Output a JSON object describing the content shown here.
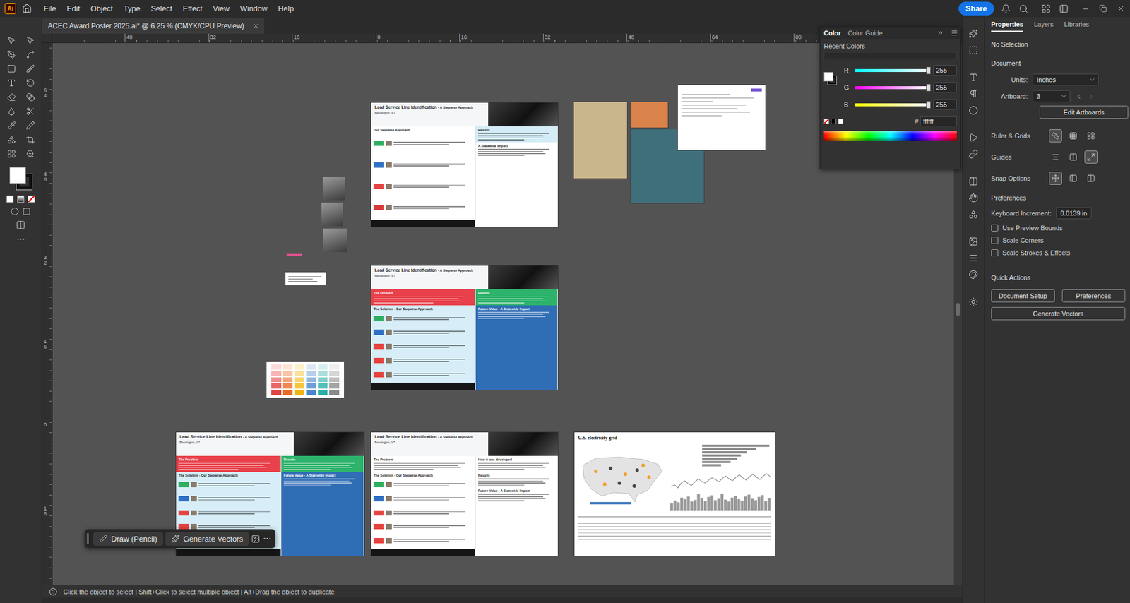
{
  "menu_bar": {
    "logo": "Ai",
    "items": [
      "File",
      "Edit",
      "Object",
      "Type",
      "Select",
      "Effect",
      "View",
      "Window",
      "Help"
    ],
    "share": "Share"
  },
  "document_tab": {
    "title": "ACEC Award Poster 2025.ai* @ 6.25 % (CMYK/CPU Preview)",
    "selected": true
  },
  "rulers": {
    "horizontal": [
      "48",
      "32",
      "16",
      "0",
      "16",
      "32",
      "48",
      "64",
      "80"
    ],
    "vertical": [
      "64",
      "48",
      "32",
      "16",
      "0",
      "16"
    ]
  },
  "artboards": [
    {
      "kind": "poster",
      "title": "Lead Service Line Identification",
      "subtitle": "- A Stepwise Approach",
      "location": "Bennington, VT",
      "left": [
        {
          "heading": "Our Stepwise Approach",
          "color": "#ffffff",
          "steps": [
            {
              "color": "#2fae5f"
            },
            {
              "color": "#2f6fc4"
            },
            {
              "color": "#e5433f"
            },
            {
              "color": "#d63a3a"
            }
          ]
        }
      ],
      "right": [
        {
          "heading": "Results",
          "color": "#d4ecf7"
        },
        {
          "heading": "A Statewide Impact",
          "color": "#ffffff"
        }
      ]
    },
    {
      "kind": "poster",
      "title": "Lead Service Line Identification",
      "subtitle": "- A Stepwise Approach",
      "location": "Bennington, VT",
      "left": [
        {
          "heading": "The Problem",
          "color": "#e8414b"
        },
        {
          "heading": "The Solution - Our Stepwise Approach",
          "color": "#d7eef8",
          "steps": [
            {
              "color": "#2fae5f"
            },
            {
              "color": "#2f6fc4"
            },
            {
              "color": "#e5433f"
            },
            {
              "color": "#e5433f"
            },
            {
              "color": "#e5433f"
            }
          ]
        }
      ],
      "right": [
        {
          "heading": "Results",
          "color": "#2db36b"
        },
        {
          "heading": "Future Value - A Statewide Impact",
          "color": "#2f6db5"
        }
      ]
    },
    {
      "kind": "poster",
      "title": "Lead Service Line Identification",
      "subtitle": "- A Stepwise Approach",
      "location": "Bennington, VT",
      "left": [
        {
          "heading": "The Problem",
          "color": "#e8414b"
        },
        {
          "heading": "The Solution - Our Stepwise Approach",
          "color": "#d7eef8",
          "steps": [
            {
              "color": "#2fae5f"
            },
            {
              "color": "#2f6fc4"
            },
            {
              "color": "#e5433f"
            },
            {
              "color": "#e5433f"
            },
            {
              "color": "#e5433f"
            }
          ]
        }
      ],
      "right": [
        {
          "heading": "Results",
          "color": "#2db36b"
        },
        {
          "heading": "Future Value - A Statewide Impact",
          "color": "#2f6db5"
        }
      ]
    },
    {
      "kind": "poster",
      "title": "Lead Service Line Identification",
      "subtitle": "- A Stepwise Approach",
      "location": "Bennington, VT",
      "left": [
        {
          "heading": "The Problem",
          "color": "#ffffff"
        },
        {
          "heading": "The Solution - Our Stepwise Approach",
          "color": "#ffffff",
          "steps": [
            {
              "color": "#2fae5f"
            },
            {
              "color": "#2f6fc4"
            },
            {
              "color": "#e5433f"
            },
            {
              "color": "#e5433f"
            },
            {
              "color": "#e5433f"
            }
          ]
        }
      ],
      "right": [
        {
          "heading": "How it was developed",
          "color": "#ffffff"
        },
        {
          "heading": "Results",
          "color": "#ffffff"
        },
        {
          "heading": "Future Value - A Statewide Impact",
          "color": "#ffffff"
        }
      ]
    },
    {
      "kind": "report",
      "title": "U.S. electricity grid",
      "bars": [
        9.2,
        7.4,
        6.1,
        5.3,
        4.8,
        3.9,
        2.6
      ],
      "line": [
        52,
        55,
        50,
        58,
        62,
        57,
        54,
        60,
        65,
        61,
        58,
        63,
        67,
        64,
        60,
        66,
        70,
        65,
        62,
        68,
        72,
        67,
        63,
        69,
        73,
        68,
        64,
        70,
        74,
        69
      ],
      "area": [
        30,
        42,
        35,
        55,
        48,
        60,
        38,
        45,
        70,
        52,
        40,
        58,
        65,
        44,
        50,
        72,
        46,
        38,
        55,
        62,
        48,
        42,
        60,
        68,
        50,
        44,
        58,
        66,
        40,
        52
      ]
    }
  ],
  "references": [
    {
      "kind": "photo",
      "color": "#c9b68c"
    },
    {
      "kind": "photo",
      "color": "#d9824a"
    },
    {
      "kind": "photo",
      "color": "#3f6f7a"
    },
    {
      "kind": "screenshot",
      "color": "#ffffff"
    }
  ],
  "photos": [
    {
      "kind": "photo"
    },
    {
      "kind": "photo"
    },
    {
      "kind": "photo"
    }
  ],
  "swatch": {
    "columns": [
      [
        "#fbdada",
        "#f6b4b4",
        "#f08e8e",
        "#ea6868",
        "#e24444"
      ],
      [
        "#fde3d3",
        "#f9c4a6",
        "#f5a57a",
        "#f0874e",
        "#ea6a24"
      ],
      [
        "#fdf0c8",
        "#fbe29a",
        "#f8d46b",
        "#f5c63d",
        "#eeb612"
      ],
      [
        "#dbe7f5",
        "#b7cfeb",
        "#92b7e0",
        "#6d9fd6",
        "#4887cb"
      ],
      [
        "#d4efee",
        "#a9dfdc",
        "#7ecfcb",
        "#53bfb9",
        "#2aaea7"
      ],
      [
        "#eeeeee",
        "#d6d6d6",
        "#bdbdbd",
        "#a4a4a4",
        "#8b8b8b"
      ]
    ]
  },
  "task_bar": {
    "buttons": [
      "Draw (Pencil)",
      "Generate Vectors"
    ]
  },
  "status_bar": {
    "text": "Click the object to select | Shift+Click to select multiple object | Alt+Drag the object to duplicate"
  },
  "color_panel": {
    "tabs": [
      {
        "label": "Color",
        "selected": true
      },
      {
        "label": "Color Guide",
        "selected": false
      }
    ],
    "recent_colors": "Recent Colors",
    "channels": [
      {
        "name": "R",
        "value": "255",
        "level": 1
      },
      {
        "name": "G",
        "value": "255",
        "level": 1
      },
      {
        "name": "B",
        "value": "255",
        "level": 1
      }
    ],
    "hex_label": "#",
    "hex": "ffffff"
  },
  "properties": {
    "tabs": [
      {
        "label": "Properties",
        "selected": true
      },
      {
        "label": "Layers",
        "selected": false
      },
      {
        "label": "Libraries",
        "selected": false
      }
    ],
    "selection": "No Selection",
    "document_heading": "Document",
    "units_label": "Units:",
    "units": "Inches",
    "artboard_label": "Artboard:",
    "artboard": "3",
    "edit_artboards": "Edit Artboards",
    "ruler_grids": "Ruler & Grids",
    "ruler_toggles": [
      {
        "on": true
      },
      {
        "on": false
      },
      {
        "on": false
      }
    ],
    "guides": "Guides",
    "guide_toggles": [
      {
        "on": false
      },
      {
        "on": false
      },
      {
        "on": true
      }
    ],
    "snap_options": "Snap Options",
    "snap_toggles": [
      {
        "on": true
      },
      {
        "on": false
      },
      {
        "on": false
      }
    ],
    "preferences_heading": "Preferences",
    "keyboard_increment_label": "Keyboard Increment:",
    "keyboard_increment": "0.0139 in",
    "checkboxes": [
      {
        "label": "Use Preview Bounds",
        "checked": false
      },
      {
        "label": "Scale Corners",
        "checked": false
      },
      {
        "label": "Scale Strokes & Effects",
        "checked": false
      }
    ],
    "quick_actions": "Quick Actions",
    "actions": [
      "Document Setup",
      "Preferences",
      "Generate Vectors"
    ]
  }
}
